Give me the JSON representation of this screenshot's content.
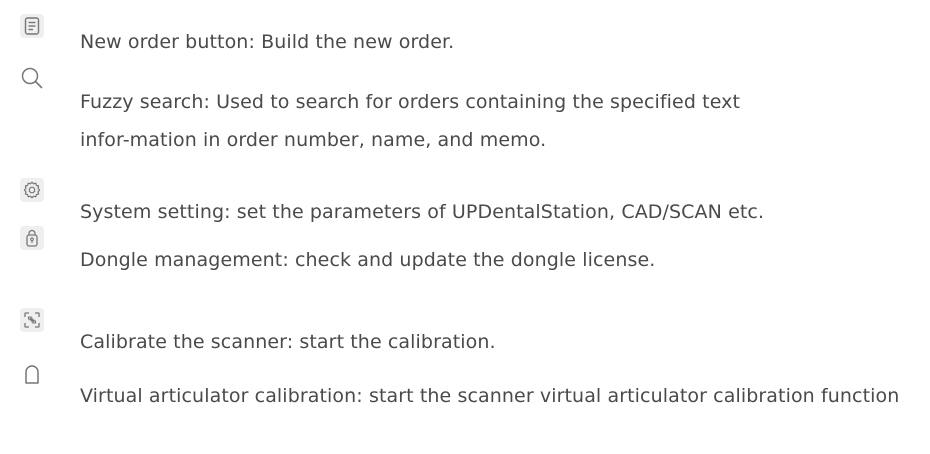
{
  "features": [
    {
      "icon": "document-list-icon",
      "text": "New order button: Build the new order."
    },
    {
      "icon": "search-icon",
      "text": "Fuzzy search: Used to search for orders containing the specified text infor-mation in order number, name, and memo."
    },
    {
      "icon": "gear-icon",
      "text": "System setting: set the parameters of UPDentalStation, CAD/SCAN etc."
    },
    {
      "icon": "dongle-lock-icon",
      "text": "Dongle management: check and update the dongle license."
    },
    {
      "icon": "scan-target-icon",
      "text": "Calibrate the scanner: start the calibration."
    },
    {
      "icon": "rounded-square-icon",
      "text": "Virtual articulator calibration: start the scanner virtual articulator calibration function"
    }
  ]
}
